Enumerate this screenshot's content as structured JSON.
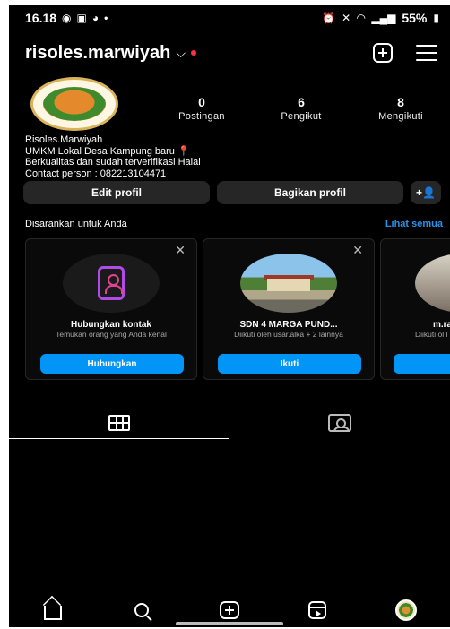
{
  "status_bar": {
    "time": "16.18",
    "battery": "55%"
  },
  "header": {
    "username": "risoles.marwiyah"
  },
  "profile": {
    "stats": [
      {
        "value": "0",
        "label": "Postingan"
      },
      {
        "value": "6",
        "label": "Pengikut"
      },
      {
        "value": "8",
        "label": "Mengikuti"
      }
    ],
    "bio": {
      "name": "Risoles.Marwiyah",
      "line1": "UMKM Lokal Desa Kampung baru",
      "line2": "Berkualitas dan sudah terverifikasi Halal",
      "line3": "Contact person : 082213104471"
    }
  },
  "buttons": {
    "edit": "Edit profil",
    "share": "Bagikan profil"
  },
  "suggestions": {
    "title": "Disarankan untuk Anda",
    "see_all": "Lihat semua",
    "cards": [
      {
        "name": "Hubungkan kontak",
        "sub": "Temukan orang yang Anda kenal",
        "action": "Hubungkan"
      },
      {
        "name": "SDN 4 MARGA PUND...",
        "sub": "Diikuti oleh usar.alka + 2 lainnya",
        "action": "Ikuti"
      },
      {
        "name": "m.ra",
        "sub": "Diikuti ol l",
        "action": ""
      }
    ]
  },
  "colors": {
    "background": "#000000",
    "accent_blue": "#0095f6",
    "link_blue": "#2b8fe8",
    "button_gray": "#262626"
  }
}
